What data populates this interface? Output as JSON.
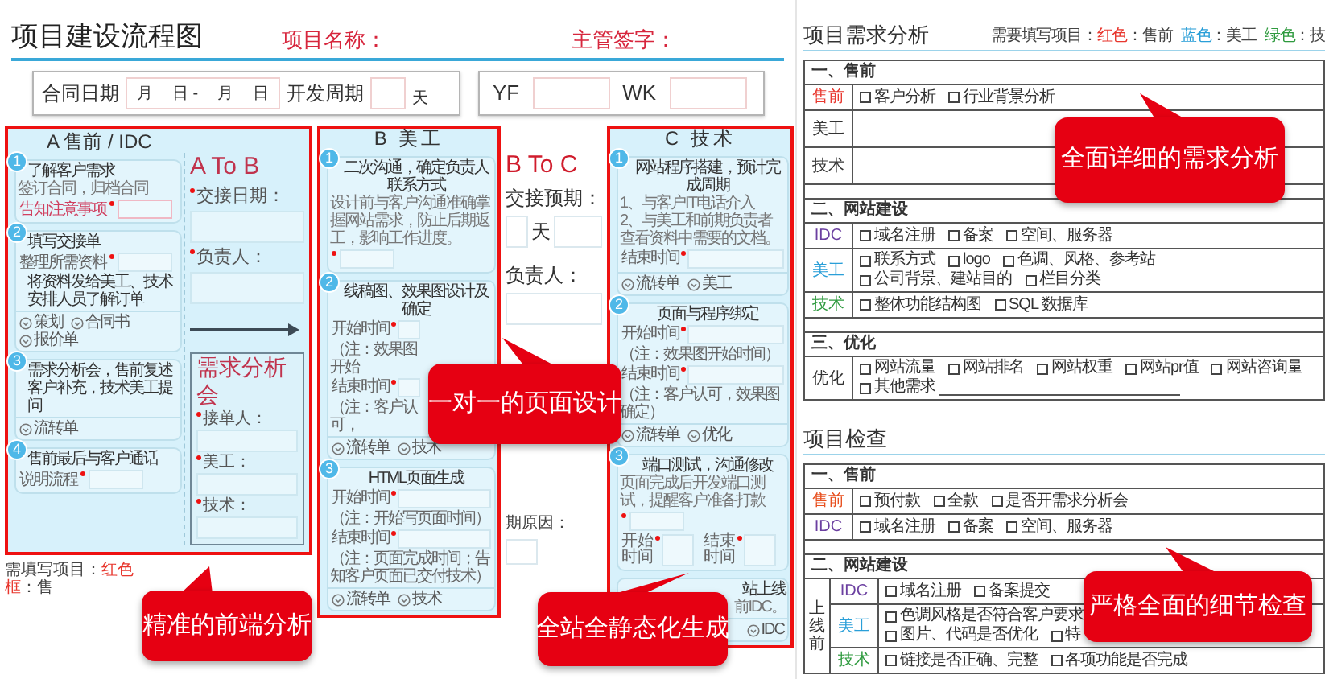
{
  "flow_chart": {
    "title": "项目建设流程图",
    "project_name": "项目名称：",
    "supervisor_sign": "主管签字：",
    "contract": {
      "label": "合同日期",
      "date_marks": [
        "月",
        "日 -",
        "月",
        "日"
      ],
      "cycle_label": "开发周期",
      "cycle_unit": "天"
    },
    "codes": [
      {
        "label": "YF"
      },
      {
        "label": "WK"
      }
    ],
    "presale": {
      "title": "A 售前 / IDC",
      "steps": [
        {
          "number": "1",
          "parts": [
            {
              "kind": "title",
              "text": "了解客户需求"
            },
            {
              "kind": "text",
              "text": "签订合同，归档合同"
            },
            {
              "kind": "field",
              "label": "告知注意事项",
              "required": true,
              "highlight": true
            }
          ]
        },
        {
          "number": "2",
          "parts": [
            {
              "kind": "title",
              "text": "填写交接单"
            },
            {
              "kind": "field",
              "label": "整理所需资料",
              "required": true,
              "highlight": false
            },
            {
              "kind": "title",
              "text": "将资料发给美工、技术安排人员了解订单"
            }
          ],
          "links": [
            "策划",
            "合同书",
            "报价单"
          ]
        },
        {
          "number": "3",
          "parts": [
            {
              "kind": "title",
              "text": "需求分析会，售前复述客户补充，技术美工提问"
            }
          ],
          "links": [
            "流转单"
          ]
        },
        {
          "number": "4",
          "parts": [
            {
              "kind": "title",
              "text": "售前最后与客户通话"
            },
            {
              "kind": "field",
              "label": "说明流程",
              "required": true,
              "highlight": false
            }
          ]
        }
      ]
    },
    "handoff_ab": {
      "title": "A To B",
      "fields": [
        {
          "label": "交接日期：",
          "required": true
        },
        {
          "label": "负责人：",
          "required": true
        }
      ],
      "meeting": {
        "title": "需求分析会",
        "fields": [
          {
            "label": "接单人：",
            "required": true
          },
          {
            "label": "美工：",
            "required": true
          },
          {
            "label": "技术：",
            "required": true
          }
        ]
      }
    },
    "design": {
      "title": "B 美工",
      "steps": [
        {
          "number": "1",
          "parts": [
            {
              "kind": "title",
              "text": "二次沟通，确定负责人联系方式"
            },
            {
              "kind": "text",
              "text": "设计前与客户沟通准确掌握网站需求，防止后期返工，影响工作进度。"
            },
            {
              "kind": "field",
              "required": true,
              "highlight": false
            }
          ]
        },
        {
          "number": "2",
          "parts": [
            {
              "kind": "title",
              "text": "线稿图、效果图设计及确定"
            },
            {
              "kind": "time",
              "label": "开始时间",
              "required": true,
              "note": "（注：效果图开始"
            },
            {
              "kind": "time",
              "label": "结束时间",
              "required": true,
              "note": "（注：客户认可，"
            }
          ],
          "links": [
            "流转单",
            "技术"
          ]
        },
        {
          "number": "3",
          "parts": [
            {
              "kind": "title",
              "text": "HTML页面生成"
            },
            {
              "kind": "time",
              "label": "开始时间",
              "required": true,
              "note": "（注：开始写页面时间）"
            },
            {
              "kind": "time",
              "label": "结束时间",
              "required": true,
              "note": "（注：页面完成时间；告知客户页面已交付技术）"
            }
          ],
          "links": [
            "流转单",
            "技术"
          ]
        }
      ]
    },
    "handoff_bc": {
      "title": "B To C",
      "expected_label": "交接预期：",
      "day_unit": "天",
      "owner_label": "负责人：",
      "reason_label": "期原因："
    },
    "tech": {
      "title": "C 技术",
      "steps": [
        {
          "number": "1",
          "parts": [
            {
              "kind": "title",
              "text": "网站程序搭建，预计完成周期"
            },
            {
              "kind": "text",
              "text": "1、与客户IT电话介入"
            },
            {
              "kind": "text",
              "text": "2、与美工和前期负责者查看资料中需要的文档。"
            },
            {
              "kind": "time",
              "label": "结束时间",
              "required": true
            }
          ],
          "links": [
            "流转单",
            "美工"
          ]
        },
        {
          "number": "2",
          "parts": [
            {
              "kind": "title",
              "text": "页面与程序绑定"
            },
            {
              "kind": "time",
              "label": "开始时间",
              "required": true,
              "note": "（注：效果图开始时间）"
            },
            {
              "kind": "time",
              "label": "结束时间",
              "required": true,
              "note": "（注：客户认可，效果图确定）"
            }
          ],
          "links": [
            "流转单",
            "优化"
          ]
        },
        {
          "number": "3",
          "parts": [
            {
              "kind": "title",
              "text": "端口测试，沟通修改"
            },
            {
              "kind": "text",
              "text": "页面完成后开发端口测试，提醒客户准备打款"
            },
            {
              "kind": "field",
              "required": true,
              "highlight": false
            },
            {
              "kind": "time_pair",
              "times": [
                {
                  "label": "开始时间",
                  "required": true
                },
                {
                  "label": "结束时间",
                  "required": true
                }
              ]
            }
          ]
        },
        {
          "parts": [
            {
              "kind": "title",
              "text": "站上线"
            },
            {
              "kind": "text",
              "text": "前IDC。"
            }
          ],
          "links": [
            "IDC"
          ]
        }
      ]
    },
    "footer_note": {
      "prefix": "需填写项目：",
      "swatch": "红色框",
      "rest": "：售"
    }
  },
  "requirements": {
    "title": "项目需求分析",
    "legend": {
      "prefix": "需要填写项目：",
      "items": [
        {
          "swatch": "红色",
          "color": "#e8382f",
          "role": "：售前"
        },
        {
          "swatch": "蓝色",
          "color": "#2a9fd8",
          "role": "：美工"
        },
        {
          "swatch": "绿色",
          "color": "#2e9a3e",
          "role": "：技"
        }
      ]
    },
    "sections": [
      {
        "heading": "一、售前",
        "spacer": true,
        "rows": [
          {
            "label": "售前",
            "color": "#e8382f",
            "kind": "options",
            "options": [
              {
                "text": "客户分析",
                "checked": false
              },
              {
                "text": "行业背景分析",
                "checked": false
              }
            ]
          },
          {
            "label": "美工",
            "color": "#333333",
            "kind": "blank"
          },
          {
            "label": "技术",
            "color": "#333333",
            "kind": "blank"
          }
        ]
      },
      {
        "heading": "二、网站建设",
        "spacer": true,
        "rows": [
          {
            "label": "IDC",
            "color": "#6b3fa0",
            "kind": "options",
            "options": [
              {
                "text": "域名注册",
                "checked": false
              },
              {
                "text": "备案",
                "checked": false
              },
              {
                "text": "空间、服务器",
                "checked": false
              }
            ]
          },
          {
            "label": "美工",
            "color": "#2a9fd8",
            "kind": "options",
            "options": [
              {
                "text": "联系方式",
                "checked": false
              },
              {
                "text": "logo",
                "checked": false
              },
              {
                "text": "色调、风格、参考站",
                "checked": false
              },
              {
                "text": "公司背景、建站目的",
                "checked": false
              },
              {
                "text": "栏目分类",
                "checked": false
              }
            ]
          },
          {
            "label": "技术",
            "color": "#2e9a3e",
            "kind": "options",
            "options": [
              {
                "text": "整体功能结构图",
                "checked": false
              },
              {
                "text": "SQL 数据库",
                "checked": false
              }
            ]
          }
        ]
      },
      {
        "heading": "三、优化",
        "spacer": false,
        "rows": [
          {
            "label": "优化",
            "color": "#333333",
            "kind": "options",
            "options": [
              {
                "text": "网站流量",
                "checked": false
              },
              {
                "text": "网站排名",
                "checked": false
              },
              {
                "text": "网站权重",
                "checked": false
              },
              {
                "text": "网站pr值",
                "checked": false
              },
              {
                "text": "网站咨询量",
                "checked": false
              },
              {
                "text": "其他需求",
                "checked": false,
                "write_in": true
              }
            ]
          }
        ]
      }
    ]
  },
  "inspection": {
    "title": "项目检查",
    "sections": [
      {
        "heading": "一、售前",
        "spacer": true,
        "rows": [
          {
            "label": "售前",
            "color": "#e8501f",
            "kind": "options",
            "options": [
              {
                "text": "预付款",
                "checked": false
              },
              {
                "text": "全款",
                "checked": false
              },
              {
                "text": "是否开需求分析会",
                "checked": false
              }
            ]
          },
          {
            "label": "IDC",
            "color": "#6b3fa0",
            "kind": "options",
            "options": [
              {
                "text": "域名注册",
                "checked": false
              },
              {
                "text": "备案",
                "checked": false
              },
              {
                "text": "空间、服务器",
                "checked": false
              }
            ]
          }
        ]
      },
      {
        "heading": "二、网站建设",
        "spacer": false,
        "group": "上线前",
        "rows": [
          {
            "label": "IDC",
            "color": "#6b3fa0",
            "kind": "options",
            "options": [
              {
                "text": "域名注册",
                "checked": false
              },
              {
                "text": "备案提交",
                "checked": false
              }
            ]
          },
          {
            "label": "美工",
            "color": "#2a9fd8",
            "kind": "option_lines",
            "lines": [
              [
                {
                  "text": "色调风格是否符合客户要求",
                  "checked": false
                }
              ],
              [
                {
                  "text": "图片、代码是否优化",
                  "checked": false
                },
                {
                  "text": "特",
                  "checked": false
                }
              ]
            ]
          },
          {
            "label": "技术",
            "color": "#2e9a3e",
            "kind": "options",
            "options": [
              {
                "text": "链接是否正确、完整",
                "checked": false
              },
              {
                "text": "各项功能是否完成",
                "checked": false
              }
            ]
          }
        ]
      }
    ]
  },
  "callouts": [
    {
      "text": "精准的前端分析"
    },
    {
      "text": "一对一的页面设计"
    },
    {
      "text": "全站全静态化生成"
    },
    {
      "text": "全面详细的需求分析"
    },
    {
      "text": "严格全面的细节检查"
    }
  ]
}
